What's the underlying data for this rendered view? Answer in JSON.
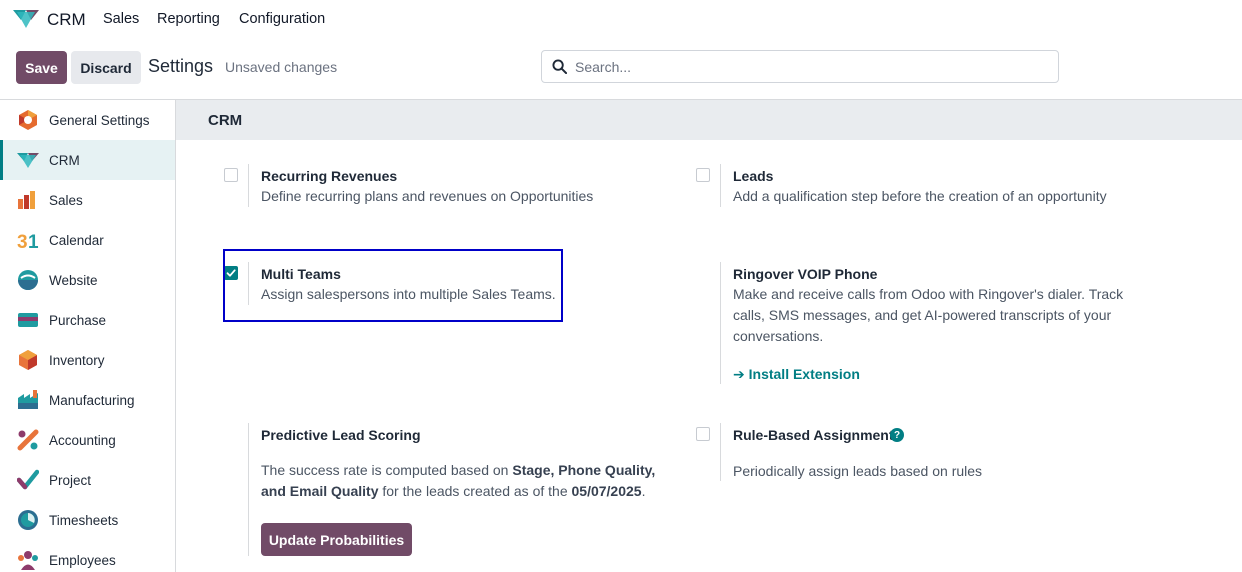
{
  "navbar": {
    "app_name": "CRM",
    "menu": [
      "Sales",
      "Reporting",
      "Configuration"
    ]
  },
  "control_panel": {
    "save_label": "Save",
    "discard_label": "Discard",
    "title": "Settings",
    "status": "Unsaved changes",
    "search_placeholder": "Search..."
  },
  "sidebar": {
    "items": [
      {
        "label": "General Settings",
        "icon": "general-settings-icon"
      },
      {
        "label": "CRM",
        "icon": "crm-icon",
        "active": true
      },
      {
        "label": "Sales",
        "icon": "sales-icon"
      },
      {
        "label": "Calendar",
        "icon": "calendar-icon"
      },
      {
        "label": "Website",
        "icon": "website-icon"
      },
      {
        "label": "Purchase",
        "icon": "purchase-icon"
      },
      {
        "label": "Inventory",
        "icon": "inventory-icon"
      },
      {
        "label": "Manufacturing",
        "icon": "manufacturing-icon"
      },
      {
        "label": "Accounting",
        "icon": "accounting-icon"
      },
      {
        "label": "Project",
        "icon": "project-icon"
      },
      {
        "label": "Timesheets",
        "icon": "timesheets-icon"
      },
      {
        "label": "Employees",
        "icon": "employees-icon"
      }
    ]
  },
  "section": {
    "title": "CRM",
    "settings": {
      "recurring": {
        "title": "Recurring Revenues",
        "desc": "Define recurring plans and revenues on Opportunities",
        "checked": false
      },
      "leads": {
        "title": "Leads",
        "desc": "Add a qualification step before the creation of an opportunity",
        "checked": false
      },
      "multi_teams": {
        "title": "Multi Teams",
        "desc": "Assign salespersons into multiple Sales Teams.",
        "checked": true
      },
      "voip": {
        "title": "Ringover VOIP Phone",
        "desc_lines": [
          "Make and receive calls from Odoo with Ringover's dialer. Track",
          "calls, SMS messages, and get AI-powered transcripts of your",
          "conversations."
        ],
        "link": "Install Extension"
      },
      "predictive": {
        "title": "Predictive Lead Scoring",
        "desc_1": "The success rate is computed based on ",
        "desc_bold_1": "Stage, Phone Quality,",
        "desc_bold_2": "and Email Quality",
        "desc_2": " for the leads created as of the ",
        "desc_bold_date": "05/07/2025",
        "desc_3": ".",
        "button": "Update Probabilities"
      },
      "rule_based": {
        "title": "Rule-Based Assignment",
        "help": "?",
        "desc": "Periodically assign leads based on rules",
        "checked": false
      }
    }
  },
  "colors": {
    "brand": "#714B67",
    "accent": "#017e84",
    "focus_outline": "#0000c8"
  }
}
